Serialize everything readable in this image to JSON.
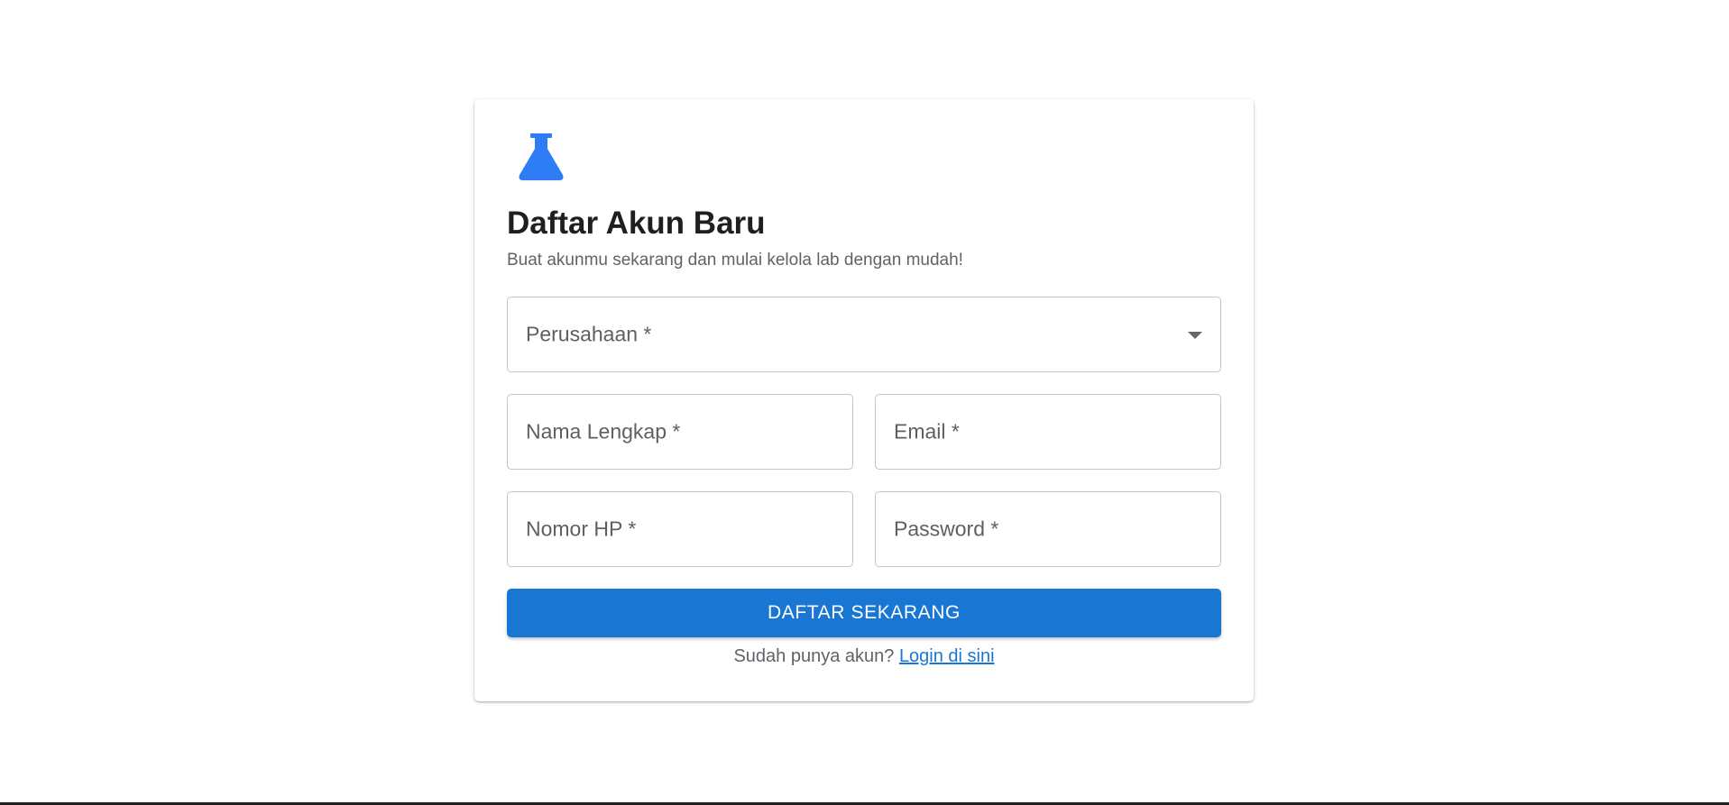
{
  "form": {
    "icon": "flask-icon",
    "title": "Daftar Akun Baru",
    "subtitle": "Buat akunmu sekarang dan mulai kelola lab dengan mudah!",
    "company_label": "Perusahaan *",
    "name_label": "Nama Lengkap *",
    "email_label": "Email *",
    "phone_label": "Nomor HP *",
    "password_label": "Password *",
    "submit_label": "DAFTAR SEKARANG",
    "login_prompt": "Sudah punya akun?",
    "login_link": "Login di sini"
  },
  "colors": {
    "accent": "#1976d2",
    "icon": "#2f7df6",
    "title": "#1f1f1f",
    "muted": "#5f6368",
    "border": "#c4c4c4"
  }
}
